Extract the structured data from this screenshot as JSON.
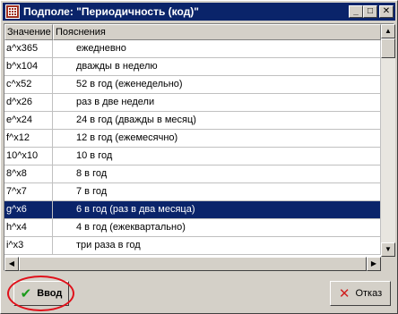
{
  "window": {
    "title": "Подполе: \"Периодичность (код)\"",
    "minimize_glyph": "_",
    "maximize_glyph": "□",
    "close_glyph": "✕"
  },
  "grid": {
    "columns": [
      "Значение",
      "Пояснения"
    ],
    "selected_index": 9,
    "rows": [
      {
        "value": "a^x365",
        "desc": "ежедневно"
      },
      {
        "value": "b^x104",
        "desc": "дважды в неделю"
      },
      {
        "value": "c^x52",
        "desc": "52 в год (еженедельно)"
      },
      {
        "value": "d^x26",
        "desc": "раз в две недели"
      },
      {
        "value": "e^x24",
        "desc": "24 в год (дважды в месяц)"
      },
      {
        "value": "f^x12",
        "desc": "12 в год (ежемесячно)"
      },
      {
        "value": "10^x10",
        "desc": "10 в год"
      },
      {
        "value": "8^x8",
        "desc": "8 в год"
      },
      {
        "value": "7^x7",
        "desc": "7 в год"
      },
      {
        "value": "g^x6",
        "desc": "6 в год (раз в два месяца)"
      },
      {
        "value": "h^x4",
        "desc": "4 в год (ежеквартально)"
      },
      {
        "value": "i^x3",
        "desc": "три раза в год"
      }
    ]
  },
  "buttons": {
    "ok_label": "Ввод",
    "cancel_label": "Отказ"
  },
  "icons": {
    "ok": "check-icon",
    "cancel": "cross-icon"
  },
  "colors": {
    "titlebar": "#0a246a",
    "selection": "#0a246a",
    "highlight_ring": "#e0101a"
  }
}
